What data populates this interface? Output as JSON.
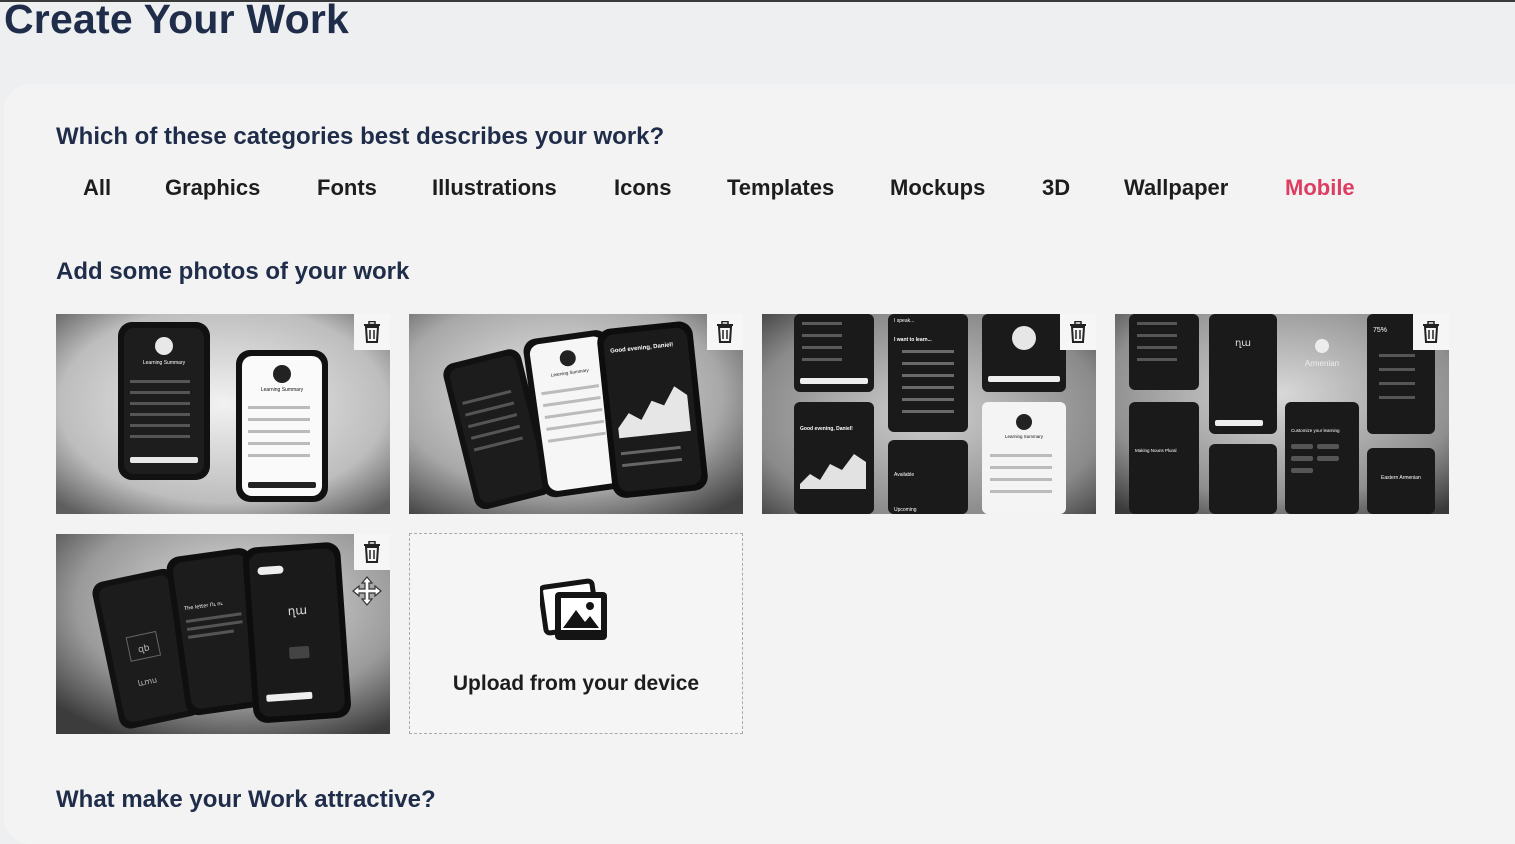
{
  "page": {
    "title": "Create Your Work"
  },
  "categories_section": {
    "question": "Which of these categories best describes your work?",
    "items": [
      "All",
      "Graphics",
      "Fonts",
      "Illustrations",
      "Icons",
      "Templates",
      "Mockups",
      "3D",
      "Wallpaper",
      "Mobile"
    ],
    "selected": "Mobile",
    "active_color": "#de3d62"
  },
  "photos_section": {
    "heading": "Add some photos of your work",
    "thumbnails": [
      {
        "name": "learning-summary-two-phones",
        "delete_icon": "trash-icon",
        "texts": [
          "Learning Summary",
          "Learning Summary"
        ]
      },
      {
        "name": "three-phones-fanned",
        "delete_icon": "trash-icon",
        "texts": [
          "Learning Summary",
          "Good evening, Daniel!"
        ]
      },
      {
        "name": "screen-grid-collage",
        "delete_icon": "trash-icon",
        "texts": [
          "I speak...",
          "I want to learn...",
          "Learning Summary",
          "Good evening, Daniel!",
          "Available",
          "Upcoming"
        ]
      },
      {
        "name": "armenian-screens",
        "delete_icon": "trash-icon",
        "texts": [
          "Armenian",
          "Customize your learning",
          "Eastern Armenian",
          "Making Nouns Plural",
          "75%"
        ]
      },
      {
        "name": "letter-lessons-phones",
        "delete_icon": "trash-icon",
        "texts": [
          "The letter Ու ու",
          "ղա"
        ]
      }
    ],
    "upload": {
      "label": "Upload from your device",
      "icon": "images-icon"
    },
    "move_cursor_icon": "move-cursor-icon"
  },
  "attractive_section": {
    "heading": "What make your Work attractive?"
  },
  "colors": {
    "heading": "#1f2d4a",
    "active": "#de3d62",
    "page_bg": "#eeeff0"
  }
}
